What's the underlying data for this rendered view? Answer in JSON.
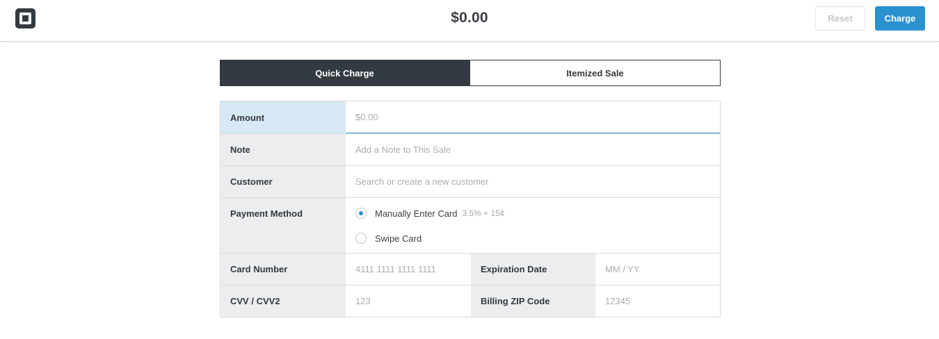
{
  "header": {
    "total": "$0.00",
    "reset_label": "Reset",
    "charge_label": "Charge"
  },
  "tabs": [
    {
      "label": "Quick Charge",
      "active": true
    },
    {
      "label": "Itemized Sale",
      "active": false
    }
  ],
  "form": {
    "amount": {
      "label": "Amount",
      "placeholder": "$0.00"
    },
    "note": {
      "label": "Note",
      "placeholder": "Add a Note to This Sale"
    },
    "customer": {
      "label": "Customer",
      "placeholder": "Search or create a new customer"
    },
    "payment": {
      "label": "Payment Method",
      "options": [
        {
          "label": "Manually Enter Card",
          "fee": "3.5% + 15¢",
          "selected": true
        },
        {
          "label": "Swipe Card",
          "fee": "",
          "selected": false
        }
      ]
    },
    "card_number": {
      "label": "Card Number",
      "placeholder": "4111 1111 1111 1111"
    },
    "expiration": {
      "label": "Expiration Date",
      "placeholder": "MM / YY"
    },
    "cvv": {
      "label": "CVV / CVV2",
      "placeholder": "123"
    },
    "zip": {
      "label": "Billing ZIP Code",
      "placeholder": "12345"
    }
  },
  "colors": {
    "accent": "#2b91cf",
    "dark": "#343a41",
    "label_bg": "#ecedef",
    "focus_bg": "#d6e9f5"
  },
  "icons": {
    "logo": "square-logo-icon"
  }
}
